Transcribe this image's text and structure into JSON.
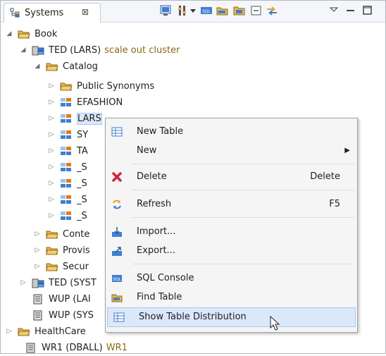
{
  "view": {
    "tab_label": "Systems",
    "tab_close_glyph": "⊠",
    "toolbar_icons": [
      "add-system-icon",
      "settings-icon",
      "dropdown-arrow-icon",
      "sql-console-icon",
      "folder-add-icon",
      "folder-open-icon",
      "collapse-all-icon",
      "link-with-editor-icon",
      "view-menu-icon",
      "minimize-icon",
      "maximize-icon"
    ]
  },
  "tree": {
    "nodes": [
      {
        "label": "Book",
        "icon": "folder-icon",
        "toggle": "◢"
      },
      {
        "label": "TED (LARS)",
        "extra": "scale out cluster",
        "icon": "system-icon",
        "toggle": "◢"
      },
      {
        "label": "Catalog",
        "icon": "folder-icon",
        "toggle": "◢"
      },
      {
        "label": "Public Synonyms",
        "icon": "folder-icon",
        "toggle": "▷"
      },
      {
        "label": "EFASHION",
        "icon": "schema-icon",
        "toggle": "▷"
      },
      {
        "label": "LARS",
        "icon": "schema-icon",
        "toggle": "▷"
      },
      {
        "label": "SY",
        "icon": "schema-icon",
        "toggle": "▷"
      },
      {
        "label": "TA",
        "icon": "schema-icon",
        "toggle": "▷"
      },
      {
        "label": "_S",
        "icon": "schema-icon",
        "toggle": "▷"
      },
      {
        "label": "_S",
        "icon": "schema-icon",
        "toggle": "▷"
      },
      {
        "label": "_S",
        "icon": "schema-icon",
        "toggle": "▷"
      },
      {
        "label": "_S",
        "icon": "schema-icon",
        "toggle": "▷"
      },
      {
        "label": "Conte",
        "icon": "folder-icon",
        "toggle": "▷"
      },
      {
        "label": "Provis",
        "icon": "folder-icon",
        "toggle": "▷"
      },
      {
        "label": "Secur",
        "icon": "folder-icon",
        "toggle": "▷"
      },
      {
        "label": "TED (SYST",
        "icon": "system-icon",
        "toggle": "▷"
      },
      {
        "label": "WUP (LAI",
        "icon": "database-icon",
        "toggle": ""
      },
      {
        "label": "WUP (SYS",
        "icon": "database-icon",
        "toggle": ""
      },
      {
        "label": "HealthCare",
        "icon": "folder-icon",
        "toggle": "▷"
      },
      {
        "label": "WR1 (DBALL)",
        "extra": "WR1",
        "icon": "database-icon",
        "toggle": ""
      }
    ]
  },
  "context_menu": {
    "items": [
      {
        "label": "New Table",
        "icon": "table-icon",
        "shortcut": ""
      },
      {
        "label": "New",
        "icon": "",
        "shortcut": "",
        "submenu_glyph": "▶"
      },
      {
        "label": "Delete",
        "icon": "delete-icon",
        "shortcut": "Delete"
      },
      {
        "label": "Refresh",
        "icon": "refresh-icon",
        "shortcut": "F5"
      },
      {
        "label": "Import...",
        "icon": "import-icon",
        "shortcut": ""
      },
      {
        "label": "Export...",
        "icon": "export-icon",
        "shortcut": ""
      },
      {
        "label": "SQL Console",
        "icon": "sql-icon",
        "shortcut": ""
      },
      {
        "label": "Find Table",
        "icon": "find-table-icon",
        "shortcut": ""
      },
      {
        "label": "Show Table Distribution",
        "icon": "table-distribution-icon",
        "shortcut": ""
      }
    ]
  },
  "colors": {
    "selection": "#dbe8fa",
    "extra_text": "#8b6a15",
    "folder": "#e8b94a",
    "schema_orange": "#e07a1f",
    "schema_blue": "#3d7fd0",
    "delete_red": "#d4213a"
  }
}
